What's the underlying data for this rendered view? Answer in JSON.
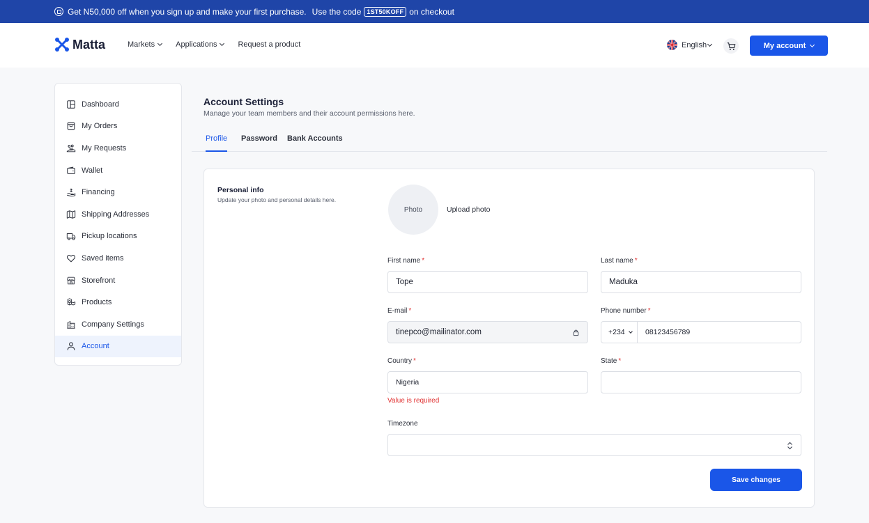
{
  "promo": {
    "text_before": "Get N50,000 off when you sign up and make your first purchase.",
    "text_code_lead": "Use the code",
    "code": "1ST50KOFF",
    "text_after": "on checkout"
  },
  "header": {
    "brand": "Matta",
    "nav": [
      {
        "label": "Markets",
        "icon": "chevron-down-icon"
      },
      {
        "label": "Applications",
        "icon": "chevron-down-icon"
      },
      {
        "label": "Request a product"
      }
    ],
    "language": "English",
    "account_button": "My account"
  },
  "sidebar": {
    "items": [
      {
        "label": "Dashboard",
        "icon": "dashboard-icon"
      },
      {
        "label": "My Orders",
        "icon": "orders-icon"
      },
      {
        "label": "My Requests",
        "icon": "requests-icon"
      },
      {
        "label": "Wallet",
        "icon": "wallet-icon"
      },
      {
        "label": "Financing",
        "icon": "financing-icon"
      },
      {
        "label": "Shipping Addresses",
        "icon": "map-icon"
      },
      {
        "label": "Pickup locations",
        "icon": "truck-icon"
      },
      {
        "label": "Saved items",
        "icon": "heart-icon"
      },
      {
        "label": "Storefront",
        "icon": "store-icon"
      },
      {
        "label": "Products",
        "icon": "boxes-icon"
      },
      {
        "label": "Company Settings",
        "icon": "building-icon"
      },
      {
        "label": "Account",
        "icon": "user-icon",
        "active": true
      }
    ]
  },
  "page": {
    "title": "Account Settings",
    "subtitle": "Manage your team members and their account permissions here.",
    "tabs": [
      {
        "label": "Profile",
        "active": true
      },
      {
        "label": "Password"
      },
      {
        "label": "Bank Accounts"
      }
    ]
  },
  "profile": {
    "section_title": "Personal info",
    "section_sub": "Update your photo and personal details here.",
    "photo_placeholder": "Photo",
    "upload_label": "Upload photo",
    "first_name": {
      "label": "First name",
      "value": "Tope"
    },
    "last_name": {
      "label": "Last name",
      "value": "Maduka"
    },
    "email": {
      "label": "E-mail",
      "value": "tinepco@mailinator.com"
    },
    "phone": {
      "label": "Phone number",
      "code": "+234",
      "value": "08123456789"
    },
    "country": {
      "label": "Country",
      "value": "Nigeria",
      "error": "Value is required"
    },
    "state": {
      "label": "State",
      "value": ""
    },
    "timezone": {
      "label": "Timezone",
      "value": ""
    },
    "required_mark": "*",
    "save_button": "Save changes"
  },
  "colors": {
    "primary": "#1a56e8",
    "promo_bg": "#1f45a8",
    "error": "#e03131"
  }
}
